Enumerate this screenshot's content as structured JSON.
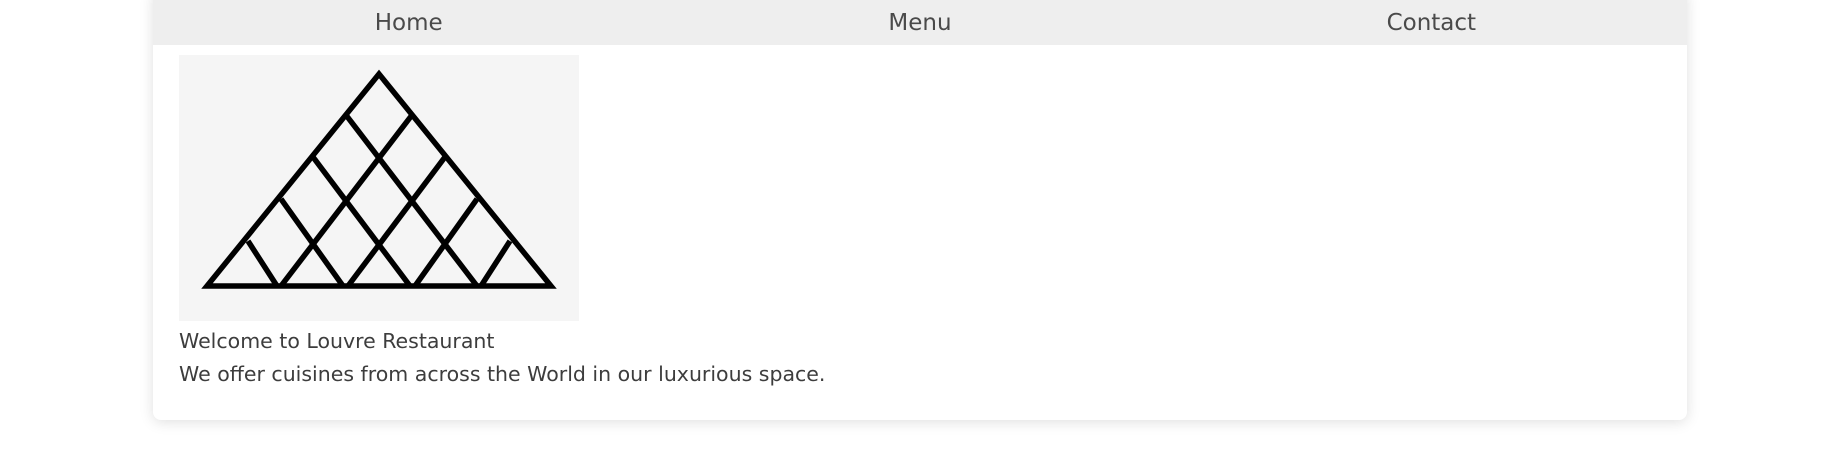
{
  "nav": {
    "items": [
      {
        "label": "Home"
      },
      {
        "label": "Menu"
      },
      {
        "label": "Contact"
      }
    ]
  },
  "logo": {
    "icon": "louvre-pyramid-icon",
    "background": "#f5f5f5",
    "stroke": "#000000"
  },
  "welcome": {
    "title": "Welcome to Louvre Restaurant",
    "description": "We offer cuisines from across the World in our luxurious space."
  },
  "colors": {
    "nav_background": "#eeeeee",
    "text": "#3d3d3d"
  }
}
